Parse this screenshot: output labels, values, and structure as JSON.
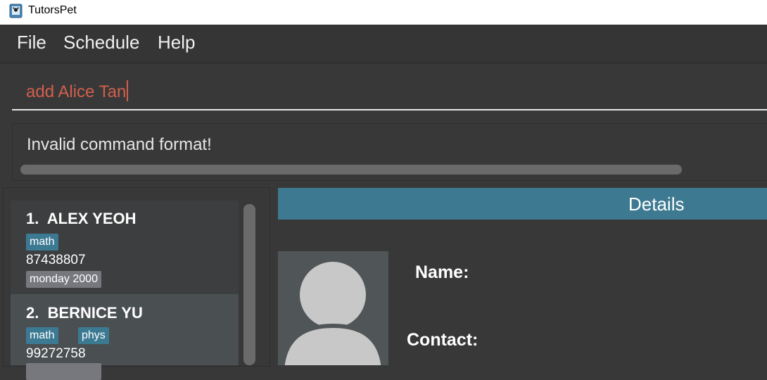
{
  "window": {
    "title": "TutorsPet"
  },
  "menu": {
    "items": [
      "File",
      "Schedule",
      "Help"
    ]
  },
  "command": {
    "value": "add Alice Tan"
  },
  "result": {
    "message": "Invalid command format!"
  },
  "students": [
    {
      "index": "1.",
      "name": "ALEX YEOH",
      "subjects": [
        "math"
      ],
      "phone": "87438807",
      "lesson": "monday 2000"
    },
    {
      "index": "2.",
      "name": "BERNICE YU",
      "subjects": [
        "math",
        "phys"
      ],
      "phone": "99272758"
    }
  ],
  "details": {
    "header": "Details",
    "name_label": "Name:",
    "contact_label": "Contact:"
  },
  "colors": {
    "accent": "#3d7a91",
    "subject_tag": "#3c7a93",
    "lesson_tag": "#77787e",
    "command_text": "#d0604c",
    "background": "#383838"
  }
}
